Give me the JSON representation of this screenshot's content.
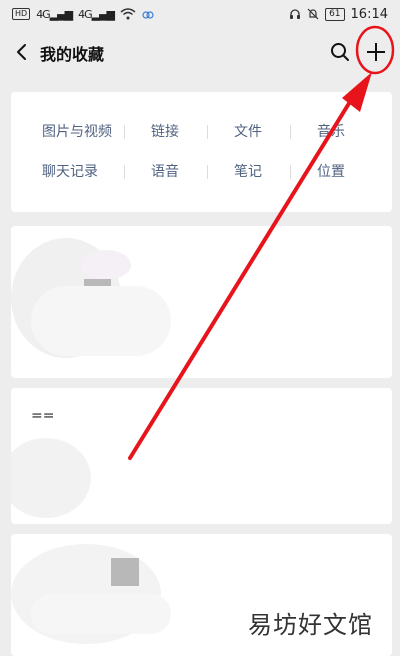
{
  "status_bar": {
    "hd_badge": "HD",
    "signal1": "4G",
    "signal2": "4G",
    "battery": "61",
    "time": "16:14"
  },
  "nav": {
    "title": "我的收藏"
  },
  "categories": {
    "row1": [
      "图片与视频",
      "链接",
      "文件",
      "音乐"
    ],
    "row2": [
      "聊天记录",
      "语音",
      "笔记",
      "位置"
    ]
  },
  "cards": {
    "card2_text": "=="
  },
  "watermark": "易坊好文馆",
  "colors": {
    "category_text": "#506282",
    "annotation_red": "#e8141b",
    "background": "#ededed"
  }
}
